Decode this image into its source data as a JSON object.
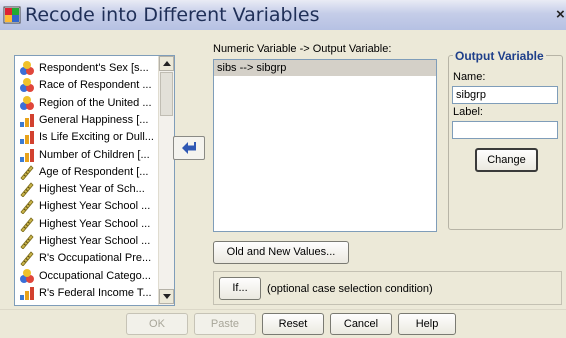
{
  "window": {
    "title": "Recode into Different Variables",
    "close": "×"
  },
  "variables": [
    {
      "label": "Respondent's Sex [s...",
      "icon": "nominal-icon"
    },
    {
      "label": "Race of Respondent ...",
      "icon": "nominal-icon"
    },
    {
      "label": "Region of the United ...",
      "icon": "nominal-icon"
    },
    {
      "label": "General Happiness [...",
      "icon": "ordinal-icon"
    },
    {
      "label": "Is Life Exciting or Dull...",
      "icon": "ordinal-icon"
    },
    {
      "label": "Number of Children [...",
      "icon": "ordinal-icon"
    },
    {
      "label": "Age of Respondent [...",
      "icon": "scale-icon"
    },
    {
      "label": "Highest Year of Sch...",
      "icon": "scale-icon"
    },
    {
      "label": "Highest Year School ...",
      "icon": "scale-icon"
    },
    {
      "label": "Highest Year School ...",
      "icon": "scale-icon"
    },
    {
      "label": "Highest Year School ...",
      "icon": "scale-icon"
    },
    {
      "label": "R's Occupational Pre...",
      "icon": "scale-icon"
    },
    {
      "label": "Occupational Catego...",
      "icon": "nominal-icon"
    },
    {
      "label": "R's Federal Income T...",
      "icon": "ordinal-icon"
    }
  ],
  "mapping": {
    "heading": "Numeric Variable -> Output Variable:",
    "items": [
      "sibs --> sibgrp"
    ]
  },
  "output": {
    "title": "Output Variable",
    "name_label": "Name:",
    "name_value": "sibgrp",
    "label_label": "Label:",
    "label_value": "",
    "change_button": "Change"
  },
  "buttons": {
    "old_new": "Old and New Values...",
    "if": "If...",
    "if_caption": "(optional case selection condition)",
    "ok": "OK",
    "paste": "Paste",
    "reset": "Reset",
    "cancel": "Cancel",
    "help": "Help"
  },
  "colors": {
    "nominal": "#3b6fd8",
    "ordinal": "#e8a31c",
    "scale": "#c9b44a",
    "accent": "#1e3f8a"
  }
}
